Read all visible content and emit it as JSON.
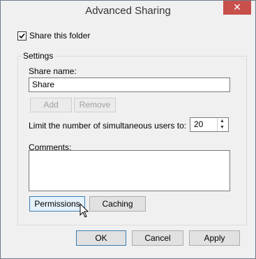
{
  "window": {
    "title": "Advanced Sharing",
    "close_glyph": "✕"
  },
  "share_checkbox": {
    "label": "Share this folder",
    "checked": true
  },
  "settings": {
    "legend": "Settings",
    "share_name_label": "Share name:",
    "share_name_value": "Share",
    "add_label": "Add",
    "remove_label": "Remove",
    "limit_label": "Limit the number of simultaneous users to:",
    "limit_value": "20",
    "comments_label": "Comments:",
    "comments_value": "",
    "permissions_label": "Permissions",
    "caching_label": "Caching"
  },
  "footer": {
    "ok_label": "OK",
    "cancel_label": "Cancel",
    "apply_label": "Apply"
  },
  "icons": {
    "up_arrow": "▲",
    "down_arrow": "▼"
  },
  "colors": {
    "close_button": "#c7504b",
    "focus_border": "#3c7fb1"
  }
}
